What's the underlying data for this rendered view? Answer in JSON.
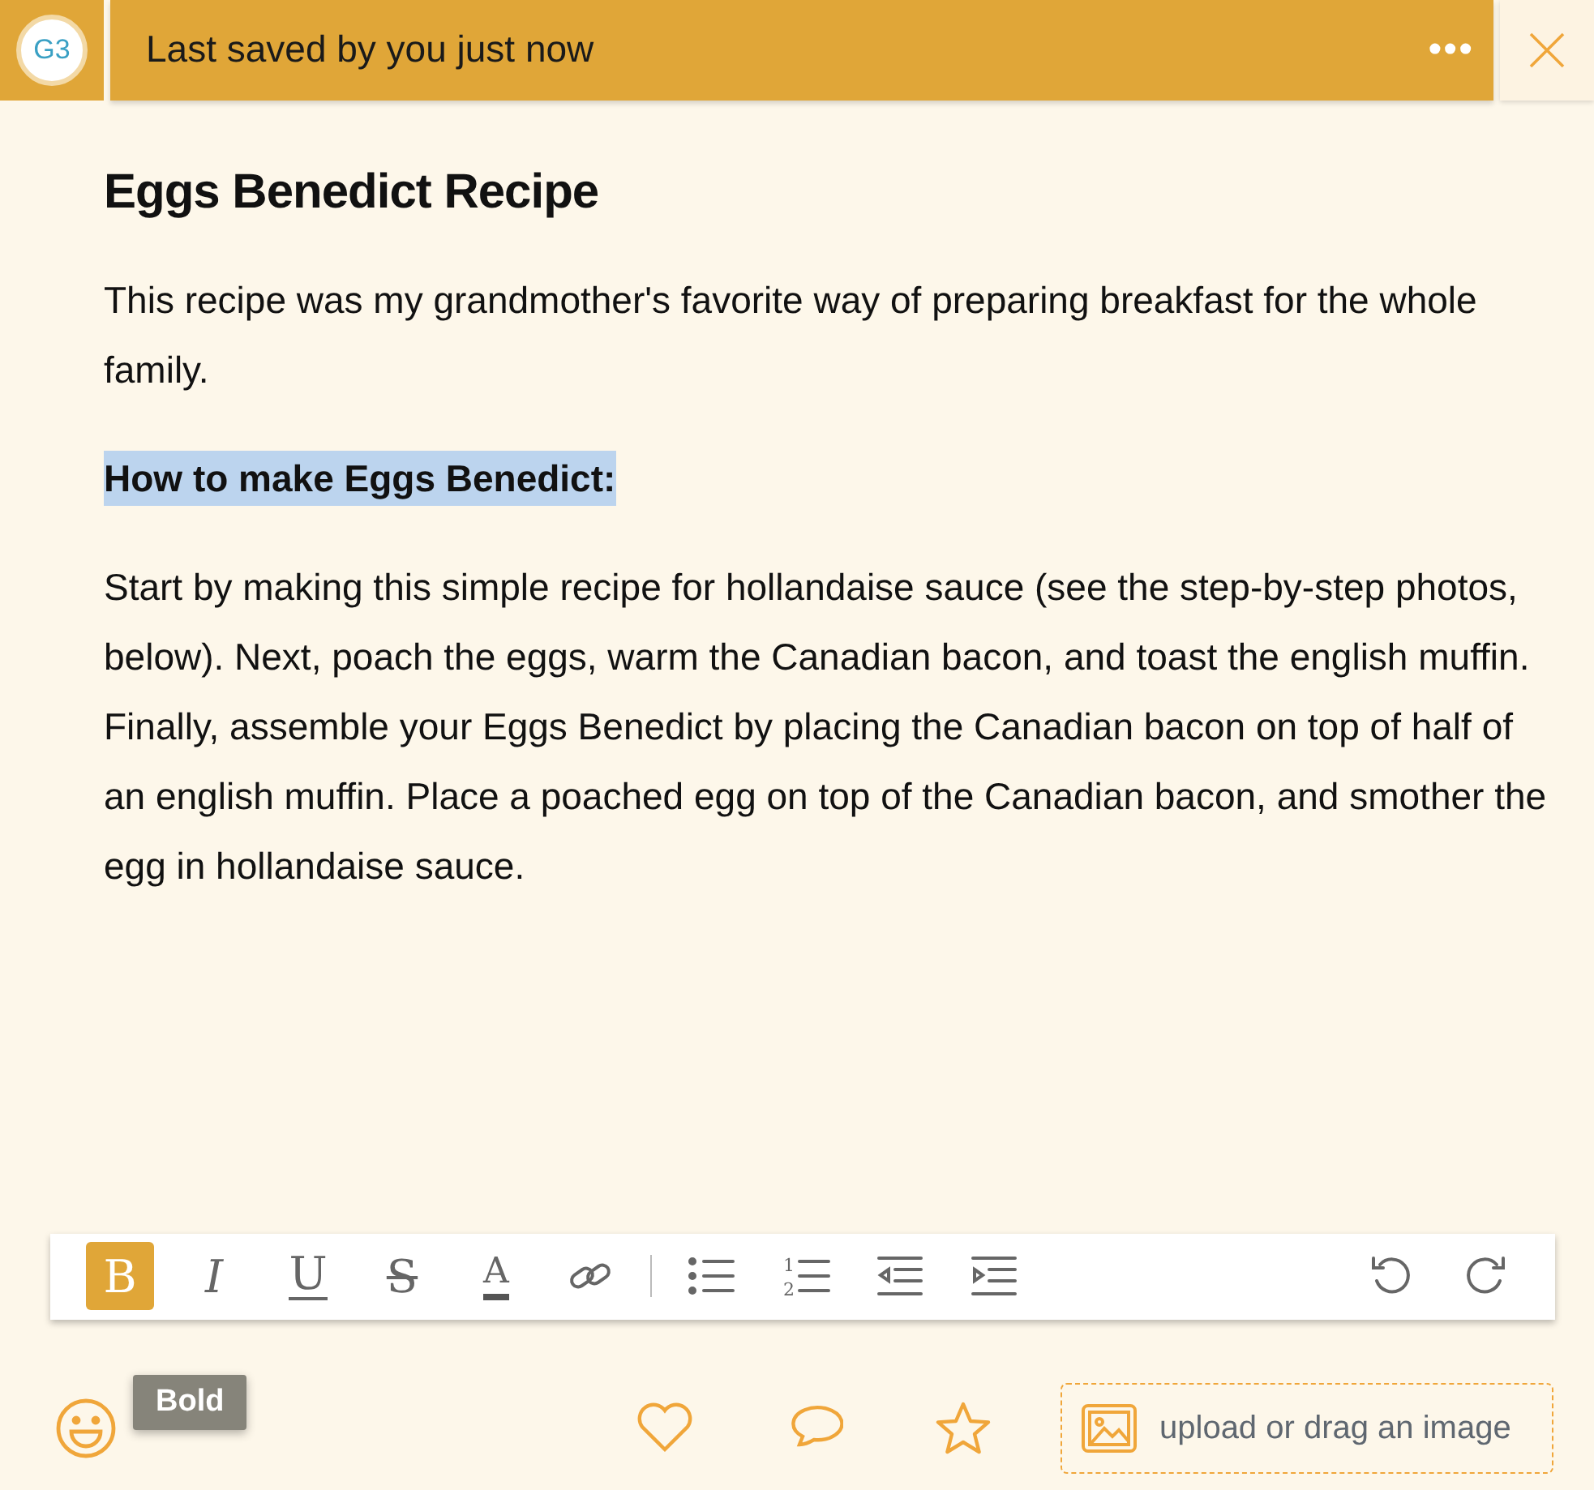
{
  "header": {
    "avatar": "G3",
    "status": "Last saved by you just now",
    "more": "•••"
  },
  "document": {
    "title": "Eggs Benedict Recipe",
    "blocks": [
      {
        "kind": "paragraph",
        "text": "This recipe was my grandmother's favorite way of preparing breakfast for the whole family.",
        "selected": false
      },
      {
        "kind": "subheading",
        "text": "How to make Eggs Benedict:",
        "selected": true
      },
      {
        "kind": "paragraph",
        "text": "Start by making this simple recipe for hollandaise sauce (see the step-by-step photos, below). Next, poach the eggs, warm the Canadian bacon, and toast the english muffin.  Finally, assemble your Eggs Benedict by placing the Canadian bacon on top of half of an english muffin.  Place a poached egg on top of the Canadian bacon, and smother the egg in hollandaise sauce.",
        "selected": false
      }
    ]
  },
  "toolbar": {
    "left": [
      {
        "kind": "bold",
        "label": "B",
        "selected": true
      },
      {
        "kind": "italic",
        "label": "I",
        "selected": false
      },
      {
        "kind": "underline",
        "label": "U",
        "selected": false
      },
      {
        "kind": "strike",
        "label": "S",
        "selected": false
      },
      {
        "kind": "color",
        "label": "A",
        "selected": false
      },
      {
        "kind": "link",
        "selected": false
      },
      {
        "kind": "bullets",
        "selected": false
      },
      {
        "kind": "numbers",
        "digits": [
          "1",
          "2"
        ],
        "selected": false
      },
      {
        "kind": "outdent",
        "selected": false
      },
      {
        "kind": "indent",
        "selected": false
      }
    ],
    "right": [
      {
        "kind": "undo"
      },
      {
        "kind": "redo"
      }
    ]
  },
  "tooltip": "Bold",
  "upload": {
    "placeholder": "upload or drag an image"
  }
}
